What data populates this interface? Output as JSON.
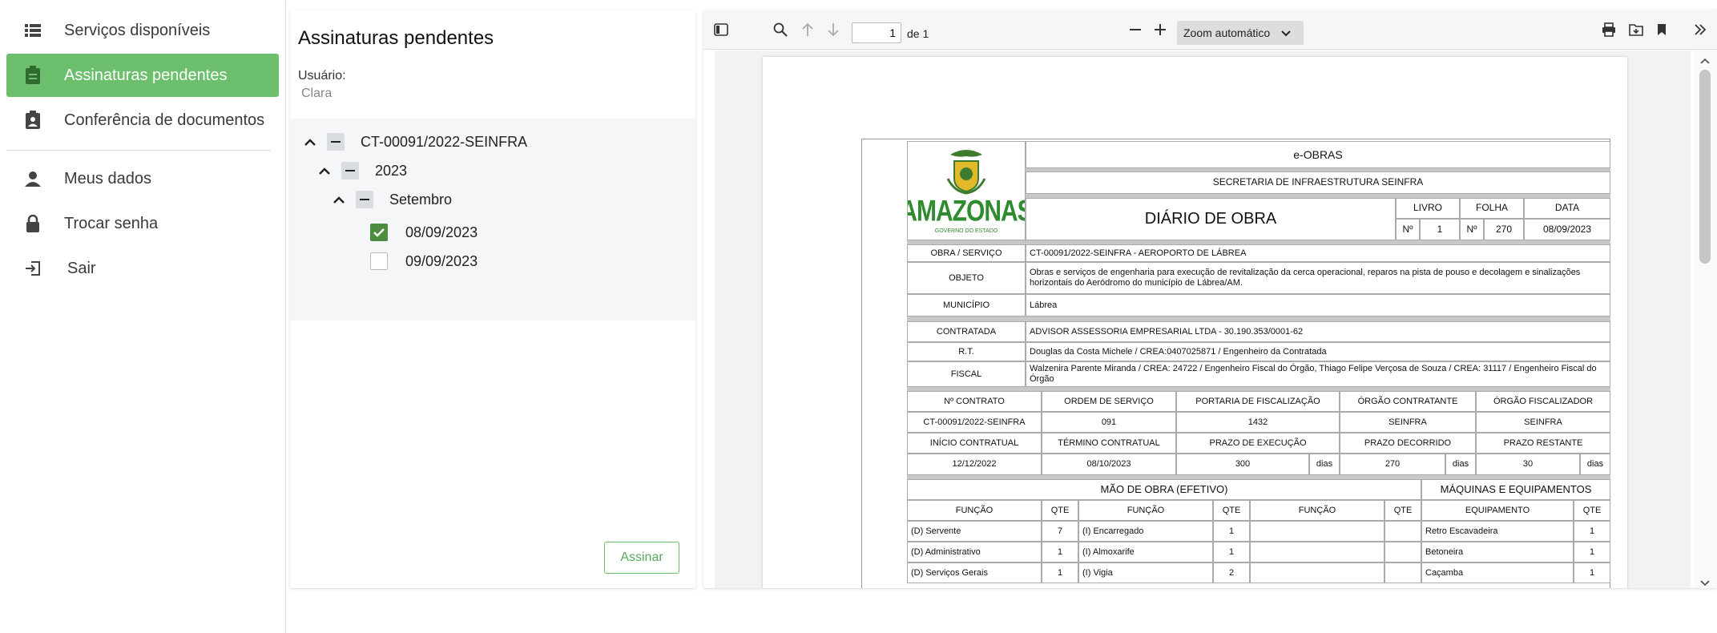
{
  "nav": {
    "items": [
      {
        "label": "Serviços disponíveis",
        "icon": "list-icon",
        "active": false
      },
      {
        "label": "Assinaturas pendentes",
        "icon": "clipboard-icon",
        "active": true
      },
      {
        "label": "Conferência de documentos",
        "icon": "clipboard-person-icon",
        "active": false
      },
      {
        "label": "Meus dados",
        "icon": "person-icon",
        "active": false
      },
      {
        "label": "Trocar senha",
        "icon": "lock-icon",
        "active": false
      },
      {
        "label": "Sair",
        "icon": "logout-icon",
        "active": false
      }
    ]
  },
  "panel": {
    "title": "Assinaturas pendentes",
    "user_label": "Usuário:",
    "user_value": "Clara",
    "tree": {
      "contract": "CT-00091/2022-SEINFRA",
      "year": "2023",
      "month": "Setembro",
      "days": [
        {
          "label": "08/09/2023",
          "checked": true
        },
        {
          "label": "09/09/2023",
          "checked": false
        }
      ]
    },
    "sign_button": "Assinar"
  },
  "viewer": {
    "page_value": "1",
    "page_of": "de 1",
    "zoom": "Zoom automático"
  },
  "document": {
    "logo_text": "AMAZONAS",
    "logo_sub": "GOVERNO DO ESTADO",
    "system": "e-OBRAS",
    "secretaria": "SECRETARIA DE INFRAESTRUTURA  SEINFRA",
    "title": "DIÁRIO DE OBRA",
    "livro_label": "LIVRO",
    "folha_label": "FOLHA",
    "data_label": "DATA",
    "no_label": "Nº",
    "livro": "1",
    "folha": "270",
    "data": "08/09/2023",
    "obra_label": "OBRA / SERVIÇO",
    "obra": "CT-00091/2022-SEINFRA - AEROPORTO DE LÁBREA",
    "objeto_label": "OBJETO",
    "objeto": "Obras e serviços de engenharia para execução de revitalização da cerca operacional, reparos na pista de pouso e decolagem e sinalizações horizontais do Aeródromo do município de Lábrea/AM.",
    "municipio_label": "MUNICÍPIO",
    "municipio": "Lábrea",
    "contratada_label": "CONTRATADA",
    "contratada": "ADVISOR ASSESSORIA EMPRESARIAL LTDA - 30.190.353/0001-62",
    "rt_label": "R.T.",
    "rt": "Douglas da Costa Michele / CREA:0407025871 / Engenheiro da Contratada",
    "fiscal_label": "FISCAL",
    "fiscal": "Walzenira Parente Miranda / CREA: 24722 / Engenheiro Fiscal do Órgão, Thiago Felipe Verçosa de Souza / CREA: 31117 / Engenheiro Fiscal do Órgão",
    "h_contrato": "Nº CONTRATO",
    "h_ordem": "ORDEM DE SERVIÇO",
    "h_portaria": "PORTARIA DE FISCALIZAÇÃO",
    "h_orgao_contr": "ÓRGÃO CONTRATANTE",
    "h_orgao_fisc": "ÓRGÃO FISCALIZADOR",
    "v_contrato": "CT-00091/2022-SEINFRA",
    "v_ordem": "091",
    "v_portaria": "1432",
    "v_orgao_contr": "SEINFRA",
    "v_orgao_fisc": "SEINFRA",
    "h_inicio": "INÍCIO CONTRATUAL",
    "h_termino": "TÉRMINO CONTRATUAL",
    "h_prazo_exec": "PRAZO DE EXECUÇÃO",
    "h_prazo_dec": "PRAZO DECORRIDO",
    "h_prazo_rest": "PRAZO RESTANTE",
    "v_inicio": "12/12/2022",
    "v_termino": "08/10/2023",
    "v_prazo_exec": "300",
    "v_prazo_dec": "270",
    "v_prazo_rest": "30",
    "dias": "dias",
    "mao_obra_title": "MÃO DE OBRA (EFETIVO)",
    "maquinas_title": "MÁQUINAS E EQUIPAMENTOS",
    "h_funcao": "FUNÇÃO",
    "h_qte": "QTE",
    "h_equip": "EQUIPAMENTO",
    "rows": [
      {
        "f1": "(D) Servente",
        "q1": "7",
        "f2": "(I) Encarregado",
        "q2": "1",
        "eq": "Retro Escavadeira",
        "qe": "1"
      },
      {
        "f1": "(D) Administrativo",
        "q1": "1",
        "f2": "(I)  Almoxarife",
        "q2": "1",
        "eq": "Betoneira",
        "qe": "1"
      },
      {
        "f1": "(D) Serviços Gerais",
        "q1": "1",
        "f2": "(I) Vigia",
        "q2": "2",
        "eq": "Caçamba",
        "qe": "1"
      }
    ]
  }
}
